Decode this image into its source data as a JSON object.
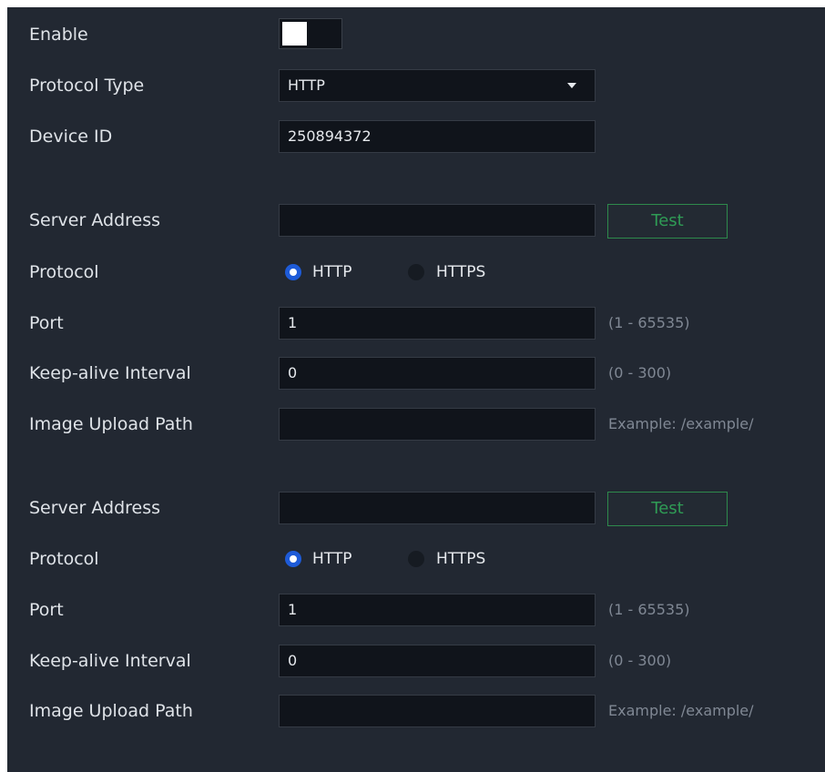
{
  "enable": {
    "label": "Enable",
    "on": true
  },
  "protocol_type": {
    "label": "Protocol Type",
    "value": "HTTP"
  },
  "device_id": {
    "label": "Device ID",
    "value": "250894372"
  },
  "servers": [
    {
      "server_address": {
        "label": "Server Address",
        "value": ""
      },
      "test_label": "Test",
      "protocol": {
        "label": "Protocol",
        "options": [
          "HTTP",
          "HTTPS"
        ],
        "selected": "HTTP"
      },
      "port": {
        "label": "Port",
        "value": "1",
        "range": "(1 - 65535)"
      },
      "keepalive": {
        "label": "Keep-alive Interval",
        "value": "0",
        "range": "(0 - 300)"
      },
      "upload_path": {
        "label": "Image Upload Path",
        "value": "",
        "example": "Example: /example/"
      }
    },
    {
      "server_address": {
        "label": "Server Address",
        "value": ""
      },
      "test_label": "Test",
      "protocol": {
        "label": "Protocol",
        "options": [
          "HTTP",
          "HTTPS"
        ],
        "selected": "HTTP"
      },
      "port": {
        "label": "Port",
        "value": "1",
        "range": "(1 - 65535)"
      },
      "keepalive": {
        "label": "Keep-alive Interval",
        "value": "0",
        "range": "(0 - 300)"
      },
      "upload_path": {
        "label": "Image Upload Path",
        "value": "",
        "example": "Example: /example/"
      }
    }
  ],
  "colors": {
    "panel_background": "#222832",
    "input_background": "#10141b",
    "test_button_accent": "#2f9b55",
    "radio_selected": "#1e5bd8"
  }
}
